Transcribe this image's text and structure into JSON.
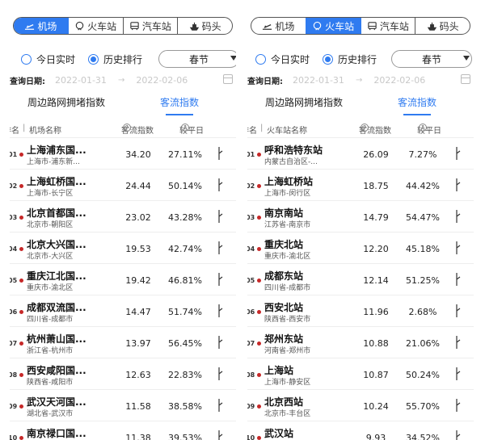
{
  "left": {
    "tabs": [
      {
        "label": "机场",
        "icon": "plane-icon",
        "active": true
      },
      {
        "label": "火车站",
        "icon": "train-icon",
        "active": false
      },
      {
        "label": "汽车站",
        "icon": "bus-icon",
        "active": false
      },
      {
        "label": "码头",
        "icon": "ship-icon",
        "active": false
      }
    ],
    "mode_realtime": "今日实时",
    "mode_history": "历史排行",
    "select_value": "春节",
    "date_label": "查询日期:",
    "date_start": "2022-01-31",
    "date_arrow": "→",
    "date_end": "2022-02-06",
    "subtab_congestion": "周边路网拥堵指数",
    "subtab_flow": "客流指数",
    "col_rank": "排名",
    "col_name": "机场名称",
    "col_index": "客流指数",
    "col_compare": "较平日",
    "rows": [
      {
        "rank": "01",
        "name": "上海浦东国...",
        "loc": "上海市-浦东新...",
        "index": "34.20",
        "pct": "27.11%"
      },
      {
        "rank": "02",
        "name": "上海虹桥国...",
        "loc": "上海市-长宁区",
        "index": "24.44",
        "pct": "50.14%"
      },
      {
        "rank": "03",
        "name": "北京首都国...",
        "loc": "北京市-朝阳区",
        "index": "23.02",
        "pct": "43.28%"
      },
      {
        "rank": "04",
        "name": "北京大兴国...",
        "loc": "北京市-大兴区",
        "index": "19.53",
        "pct": "42.74%"
      },
      {
        "rank": "05",
        "name": "重庆江北国...",
        "loc": "重庆市-渝北区",
        "index": "19.42",
        "pct": "46.81%"
      },
      {
        "rank": "06",
        "name": "成都双流国...",
        "loc": "四川省-成都市",
        "index": "14.47",
        "pct": "51.74%"
      },
      {
        "rank": "07",
        "name": "杭州萧山国...",
        "loc": "浙江省-杭州市",
        "index": "13.97",
        "pct": "56.45%"
      },
      {
        "rank": "08",
        "name": "西安咸阳国...",
        "loc": "陕西省-咸阳市",
        "index": "12.63",
        "pct": "22.83%"
      },
      {
        "rank": "09",
        "name": "武汉天河国...",
        "loc": "湖北省-武汉市",
        "index": "11.58",
        "pct": "38.58%"
      },
      {
        "rank": "10",
        "name": "南京禄口国...",
        "loc": "",
        "index": "11.38",
        "pct": "39.53%"
      }
    ]
  },
  "right": {
    "tabs": [
      {
        "label": "机场",
        "icon": "plane-icon",
        "active": false
      },
      {
        "label": "火车站",
        "icon": "train-icon",
        "active": true
      },
      {
        "label": "汽车站",
        "icon": "bus-icon",
        "active": false
      },
      {
        "label": "码头",
        "icon": "ship-icon",
        "active": false
      }
    ],
    "mode_realtime": "今日实时",
    "mode_history": "历史排行",
    "select_value": "春节",
    "date_label": "查询日期:",
    "date_start": "2022-01-31",
    "date_arrow": "→",
    "date_end": "2022-02-06",
    "subtab_congestion": "周边路网拥堵指数",
    "subtab_flow": "客流指数",
    "col_rank": "排名",
    "col_name": "火车站名称",
    "col_index": "客流指数",
    "col_compare": "较平日",
    "rows": [
      {
        "rank": "01",
        "name": "呼和浩特东站",
        "loc": "内蒙古自治区-...",
        "index": "26.09",
        "pct": "7.27%"
      },
      {
        "rank": "02",
        "name": "上海虹桥站",
        "loc": "上海市-闵行区",
        "index": "18.75",
        "pct": "44.42%"
      },
      {
        "rank": "03",
        "name": "南京南站",
        "loc": "江苏省-南京市",
        "index": "14.79",
        "pct": "54.47%"
      },
      {
        "rank": "04",
        "name": "重庆北站",
        "loc": "重庆市-渝北区",
        "index": "12.20",
        "pct": "45.18%"
      },
      {
        "rank": "05",
        "name": "成都东站",
        "loc": "四川省-成都市",
        "index": "12.14",
        "pct": "51.25%"
      },
      {
        "rank": "06",
        "name": "西安北站",
        "loc": "陕西省-西安市",
        "index": "11.96",
        "pct": "2.68%"
      },
      {
        "rank": "07",
        "name": "郑州东站",
        "loc": "河南省-郑州市",
        "index": "10.88",
        "pct": "21.06%"
      },
      {
        "rank": "08",
        "name": "上海站",
        "loc": "上海市-静安区",
        "index": "10.87",
        "pct": "50.24%"
      },
      {
        "rank": "09",
        "name": "北京西站",
        "loc": "北京市-丰台区",
        "index": "10.24",
        "pct": "55.70%"
      },
      {
        "rank": "10",
        "name": "武汉站",
        "loc": "",
        "index": "9.93",
        "pct": "34.52%"
      }
    ]
  },
  "colors": {
    "accent": "#2f7bf0",
    "rank_dot": "#c62828"
  }
}
